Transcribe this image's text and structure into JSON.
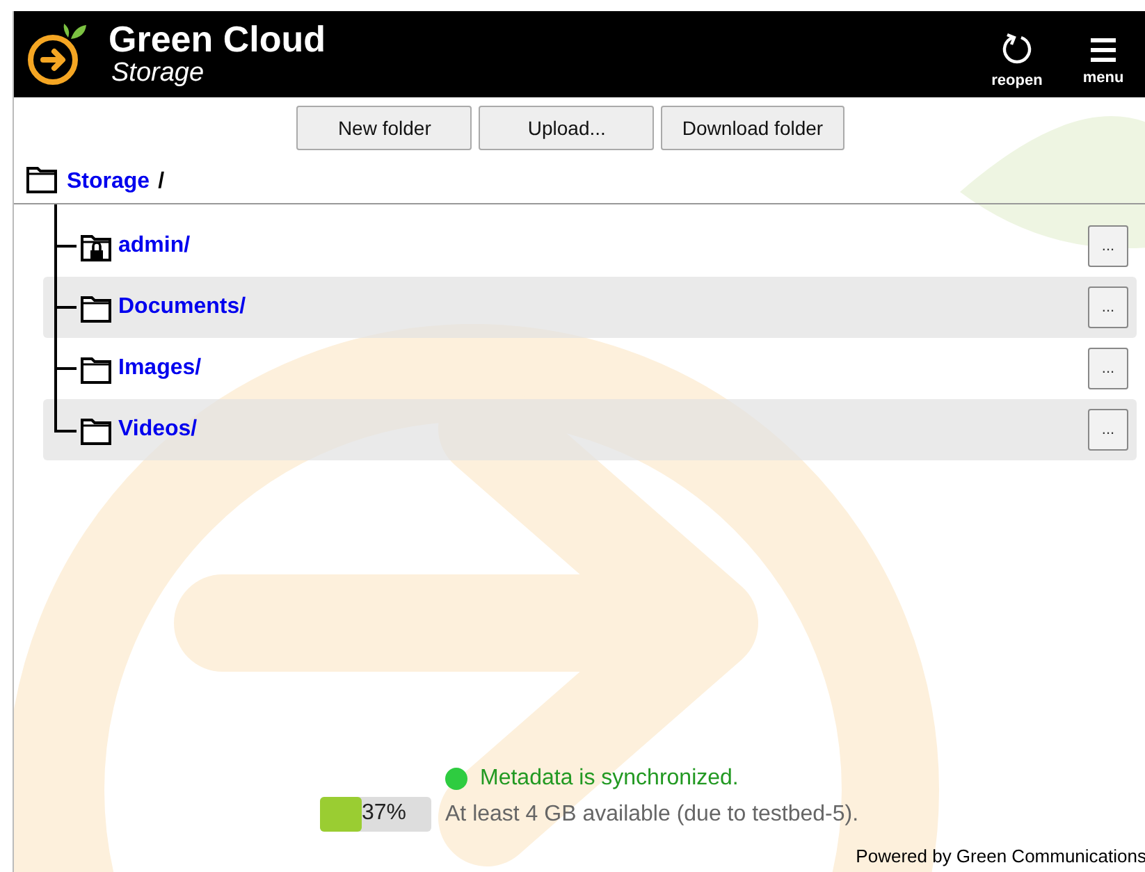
{
  "header": {
    "title": "Green Cloud",
    "subtitle": "Storage",
    "actions": [
      {
        "kind": "reopen",
        "label": "reopen"
      },
      {
        "kind": "menu",
        "label": "menu"
      }
    ]
  },
  "toolbar": [
    "New folder",
    "Upload...",
    "Download folder"
  ],
  "breadcrumb": {
    "link": "Storage",
    "separator": "/"
  },
  "folders": [
    {
      "name": "admin/",
      "locked": true,
      "action": "..."
    },
    {
      "name": "Documents/",
      "locked": false,
      "action": "..."
    },
    {
      "name": "Images/",
      "locked": false,
      "action": "..."
    },
    {
      "name": "Videos/",
      "locked": false,
      "action": "..."
    }
  ],
  "status": {
    "sync": "Metadata is synchronized.",
    "synced": true,
    "usage": {
      "level": 0.37,
      "reading": "37%"
    },
    "available": "At least 4 GB available (due to testbed-5)."
  },
  "footer": "Powered by Green Communications"
}
